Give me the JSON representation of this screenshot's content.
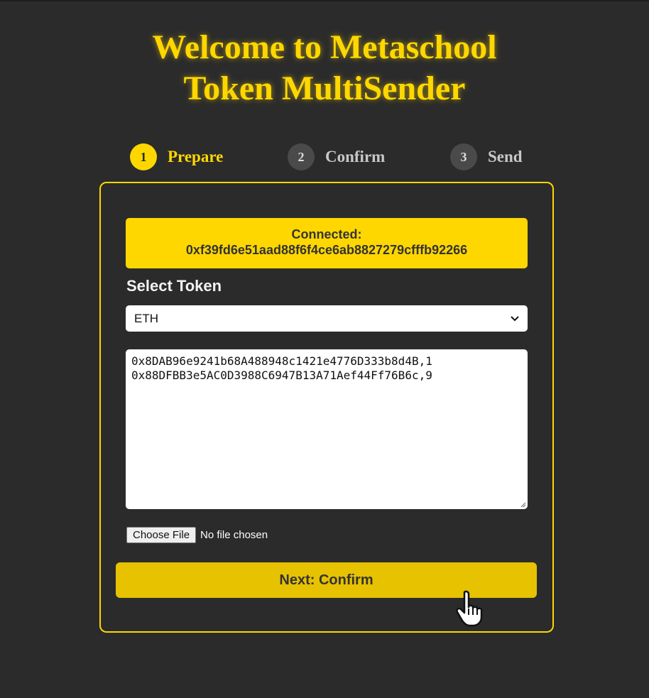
{
  "header": {
    "title_line1": "Welcome to Metaschool",
    "title_line2": "Token MultiSender"
  },
  "steps": [
    {
      "number": "1",
      "label": "Prepare",
      "active": true
    },
    {
      "number": "2",
      "label": "Confirm",
      "active": false
    },
    {
      "number": "3",
      "label": "Send",
      "active": false
    }
  ],
  "connection": {
    "label": "Connected:",
    "address": "0xf39fd6e51aad88f6f4ce6ab8827279cfffb92266"
  },
  "token": {
    "label": "Select Token",
    "selected": "ETH"
  },
  "recipients": {
    "lines": [
      "0x8DAB96e9241b68A488948c1421e4776D333b8d4B,1",
      "0x88DFBB3e5AC0D3988C6947B13A71Aef44Ff76B6c,9"
    ]
  },
  "file": {
    "button_label": "Choose File",
    "status": "No file chosen"
  },
  "next_button": "Next: Confirm",
  "colors": {
    "accent": "#ffd700",
    "background": "#2b2b2b",
    "button": "#e6c200"
  }
}
